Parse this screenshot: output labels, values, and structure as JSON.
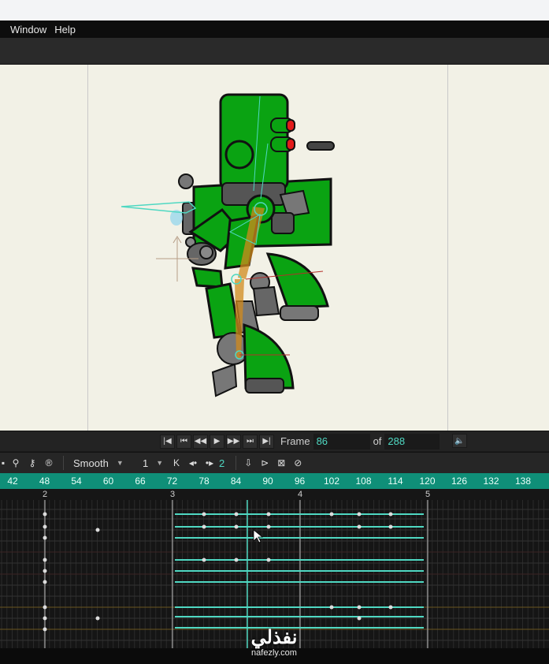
{
  "menu": {
    "items": [
      "Window",
      "Help"
    ]
  },
  "playback": {
    "frame_label": "Frame",
    "current_frame": "86",
    "of_label": "of",
    "total_frames": "288",
    "buttons": [
      "first-frame",
      "previous-keyframe",
      "step-back",
      "play",
      "step-forward",
      "next-keyframe",
      "last-frame"
    ]
  },
  "timeline_toolbar": {
    "interpolation": "Smooth",
    "step_value": "1",
    "key_step": "2"
  },
  "ruler": {
    "labels": [
      "42",
      "48",
      "54",
      "60",
      "66",
      "72",
      "78",
      "84",
      "90",
      "96",
      "102",
      "108",
      "114",
      "120",
      "126",
      "132",
      "138"
    ]
  },
  "keyframe_markers": [
    "2",
    "3",
    "4",
    "5"
  ],
  "colors": {
    "accent": "#0f8f78",
    "playhead": "#4fd8c2",
    "stage": "#f2f1e6",
    "robot_green": "#0aa312"
  },
  "watermark": {
    "arabic": "نفذلي",
    "url": "nafezly.com"
  }
}
